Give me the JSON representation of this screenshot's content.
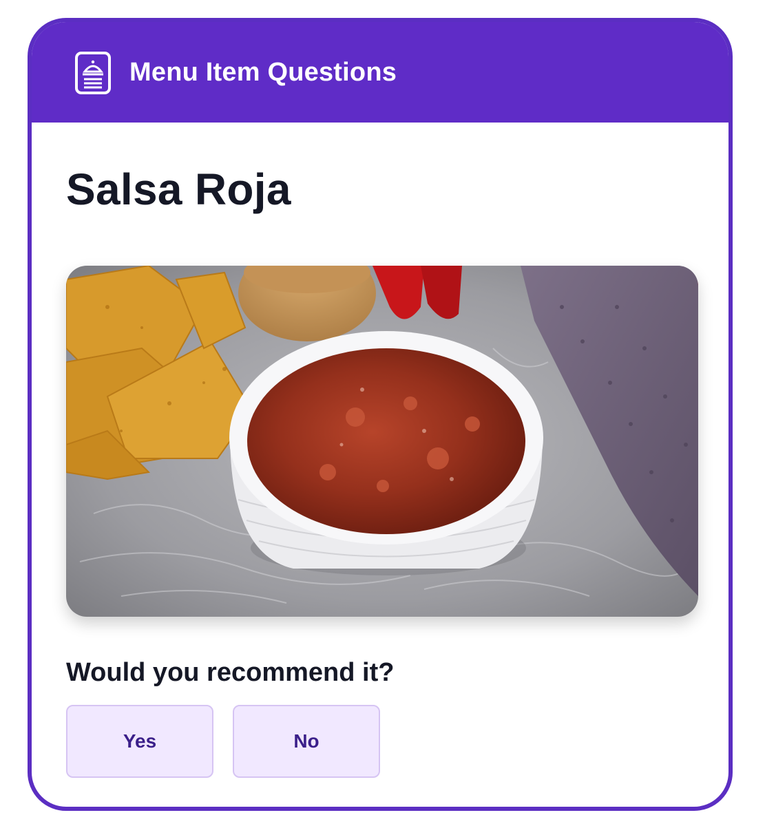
{
  "header": {
    "title": "Menu Item Questions",
    "icon": "menu-document-icon",
    "background_color": "#5f2cc7"
  },
  "item": {
    "name": "Salsa Roja",
    "image": "salsa-roja-photo"
  },
  "question": {
    "text": "Would you recommend it?",
    "options": [
      {
        "label": "Yes"
      },
      {
        "label": "No"
      }
    ]
  },
  "colors": {
    "accent": "#5f2cc7",
    "border": "#5b2ec2",
    "button_bg": "#f1e8ff",
    "button_text": "#3b1f8a",
    "title_text": "#151826"
  }
}
